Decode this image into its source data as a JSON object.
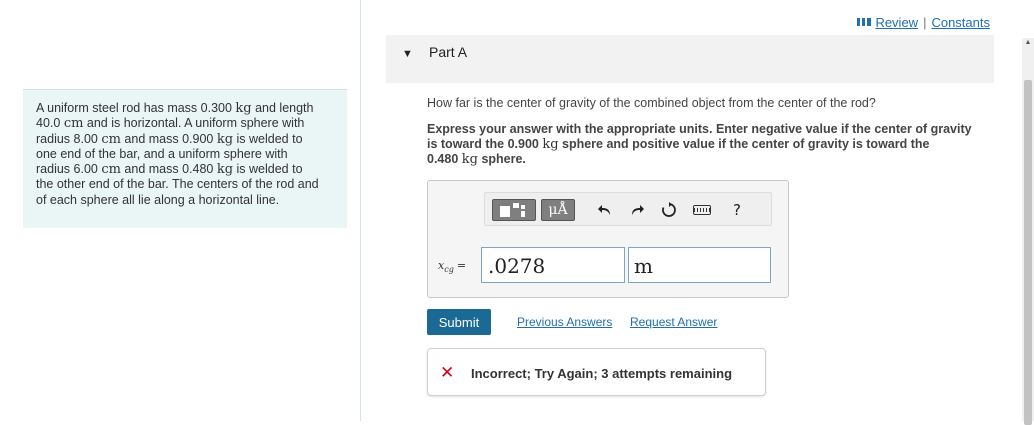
{
  "header": {
    "review_label": "Review",
    "separator": "|",
    "constants_label": "Constants"
  },
  "problem": {
    "lines": [
      {
        "pre": "A uniform steel rod has mass 0.300 ",
        "unit": "kg",
        "post": " and length"
      },
      {
        "pre": "40.0 ",
        "unit": "cm",
        "post": " and is horizontal. A uniform sphere with"
      },
      {
        "pre": "radius 8.00 ",
        "unit": "cm",
        "post": " and mass 0.900 "
      },
      {
        "pre": "",
        "unit": "kg",
        "post": " is welded to"
      },
      {
        "pre": "one end of the bar, and a uniform sphere with",
        "unit": "",
        "post": ""
      },
      {
        "pre": "radius 6.00 ",
        "unit": "cm",
        "post": " and mass 0.480 "
      },
      {
        "pre": "",
        "unit": "kg",
        "post": " is welded to"
      },
      {
        "pre": "the other end of the bar. The centers of the rod and",
        "unit": "",
        "post": ""
      },
      {
        "pre": "of each sphere all lie along a horizontal line.",
        "unit": "",
        "post": ""
      }
    ]
  },
  "part": {
    "title": "Part A"
  },
  "question": {
    "prompt": "How far is the center of gravity of the combined object from the center of the rod?",
    "instr_1": "Express your answer with the appropriate units. Enter negative value if the center of gravity",
    "instr_2": "is toward the 0.900 ",
    "instr_2_unit": "kg",
    "instr_2_post": " sphere and positive value if the center of gravity is toward the",
    "instr_3": "0.480 ",
    "instr_3_unit": "kg",
    "instr_3_post": " sphere."
  },
  "toolbar": {
    "units_label": "μÅ",
    "help_label": "?",
    "icons": [
      "templates-icon",
      "undo-icon",
      "redo-icon",
      "reset-icon",
      "keyboard-icon",
      "help-icon"
    ]
  },
  "answer": {
    "variable": "x",
    "variable_sub": "cg",
    "equals": "=",
    "value": ".0278",
    "unit": "m"
  },
  "actions": {
    "submit_label": "Submit",
    "previous_answers_label": "Previous Answers",
    "request_answer_label": "Request Answer"
  },
  "feedback": {
    "icon": "incorrect-x-icon",
    "message": "Incorrect; Try Again; 3 attempts remaining",
    "color": "#d0021b"
  },
  "colors": {
    "accent": "#1b6a96",
    "link": "#1f6fb2",
    "panel_bg": "#eaf5f6"
  }
}
